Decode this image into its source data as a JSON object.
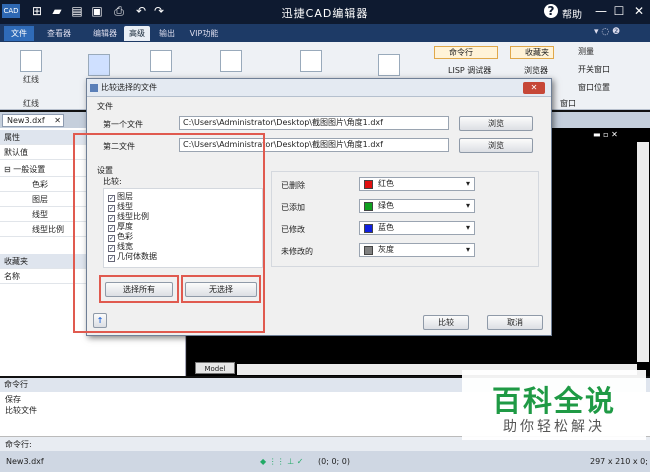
{
  "app": {
    "title": "迅捷CAD编辑器",
    "help_label": "帮助",
    "logo": "CAD"
  },
  "ribbon": {
    "tabs": [
      {
        "label": "文件"
      },
      {
        "label": "查看器"
      },
      {
        "label": "编辑器"
      },
      {
        "label": "高级"
      },
      {
        "label": "输出"
      },
      {
        "label": "VIP功能"
      }
    ],
    "buttons": {
      "redline": "红线",
      "redline_group": "红线",
      "command_line": "命令行",
      "lisp_debugger": "LISP 调试器",
      "favorites": "收藏夹",
      "browser": "浏览器",
      "measure": "测量",
      "toggle_window": "开关窗口",
      "window_position": "窗口位置",
      "window_group": "窗口"
    }
  },
  "doc_tab": {
    "label": "New3.dxf"
  },
  "left_panel": {
    "properties_title": "属性",
    "default_value": "默认值",
    "general_settings": "一般设置",
    "items": [
      "色彩",
      "图层",
      "线型",
      "线型比例"
    ],
    "favorites_title": "收藏夹",
    "name_header": "名称"
  },
  "model_tab": "Model",
  "command": {
    "title": "命令行",
    "history": [
      "保存",
      "比较文件"
    ],
    "prompt": "命令行:"
  },
  "status": {
    "file": "New3.dxf",
    "coords": "(0; 0; 0)",
    "size": "297 x 210 x 0;"
  },
  "watermark": {
    "main": "百科全说",
    "sub": "助你轻松解决"
  },
  "dialog": {
    "title": "比较选择的文件",
    "files_section": "文件",
    "first_file_label": "第一个文件",
    "first_file_path": "C:\\Users\\Administrator\\Desktop\\截图图片\\角度1.dxf",
    "second_file_label": "第二文件",
    "second_file_path": "C:\\Users\\Administrator\\Desktop\\截图图片\\角度1.dxf",
    "browse_label": "浏览",
    "settings_section": "设置",
    "compare_label": "比较:",
    "compare_items": [
      "图层",
      "线型",
      "线型比例",
      "厚度",
      "色彩",
      "线宽",
      "几何体数据"
    ],
    "select_all": "选择所有",
    "select_none": "无选择",
    "color_rows": [
      {
        "label": "已删除",
        "value": "红色",
        "color": "#e01010"
      },
      {
        "label": "已添加",
        "value": "绿色",
        "color": "#10a020"
      },
      {
        "label": "已修改",
        "value": "蓝色",
        "color": "#1020e0"
      },
      {
        "label": "未修改的",
        "value": "灰度",
        "color": "#808080"
      }
    ],
    "compare_button": "比较",
    "cancel_button": "取消"
  }
}
